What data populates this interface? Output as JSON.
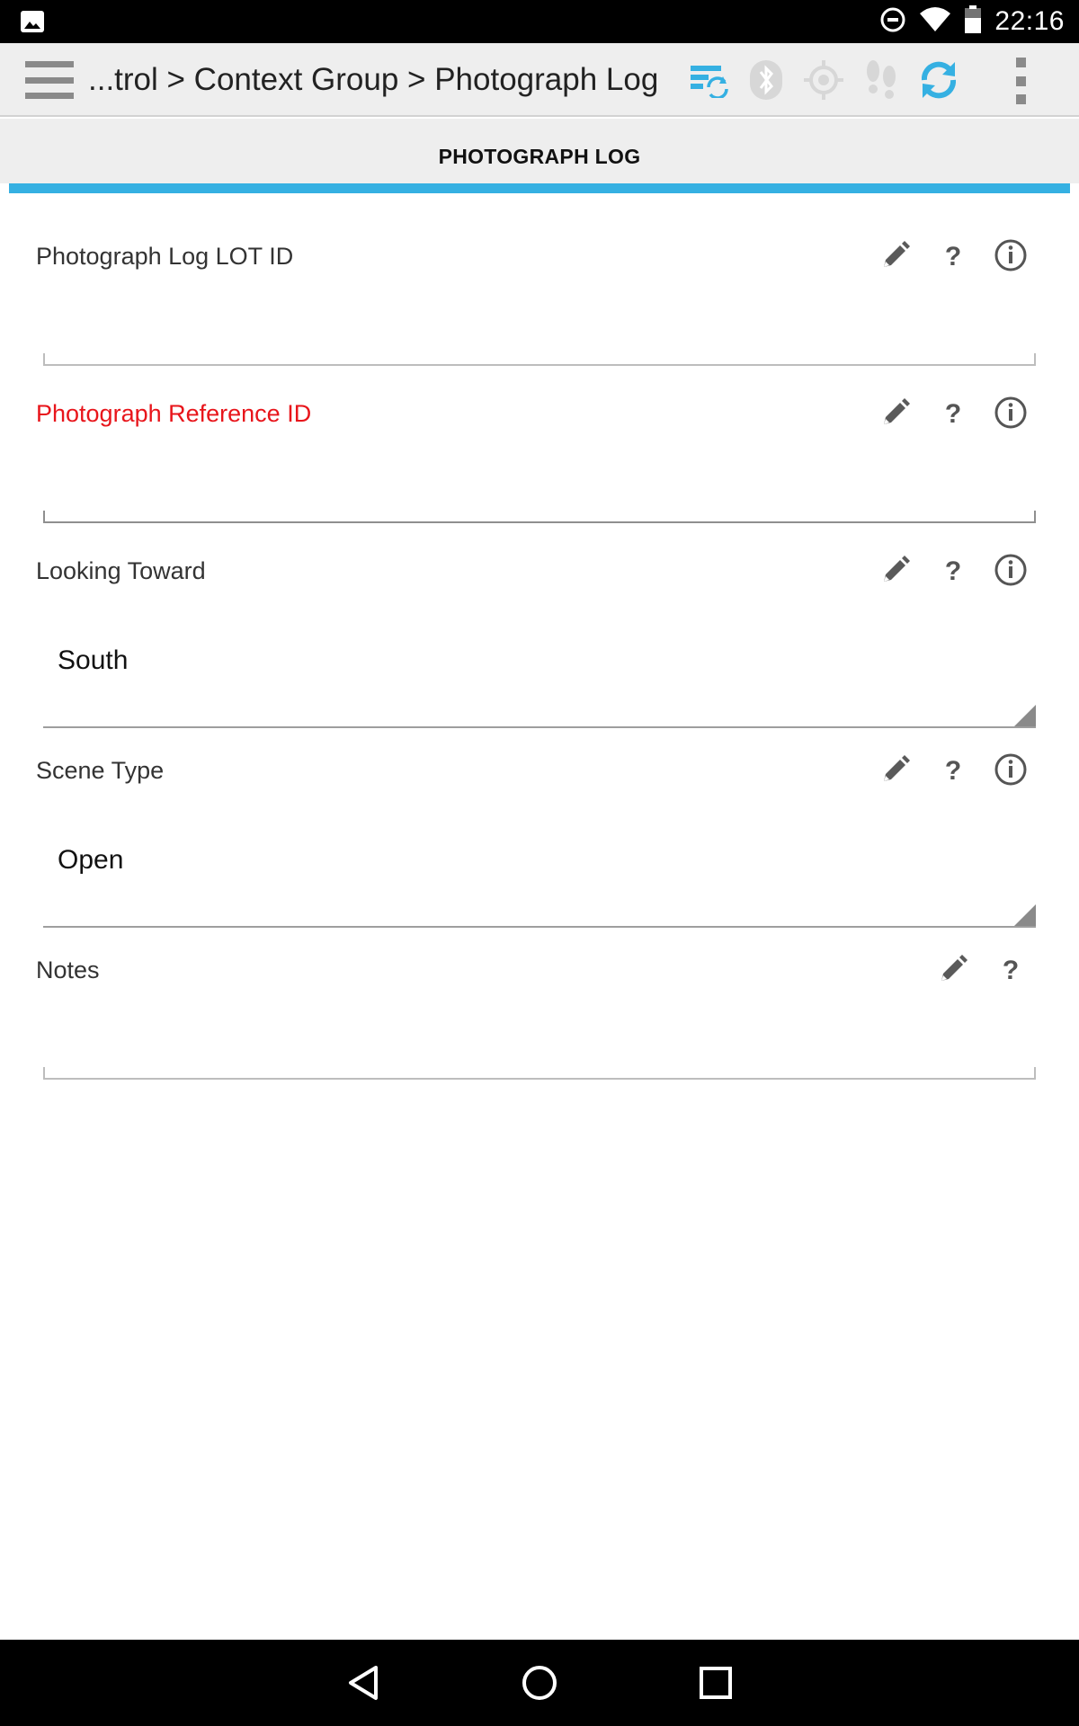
{
  "status_bar": {
    "time": "22:16",
    "icons": [
      "image-notification-icon",
      "do-not-disturb-icon",
      "wifi-icon",
      "battery-icon"
    ]
  },
  "action_bar": {
    "breadcrumb": "...trol > Context Group > Photograph Log",
    "icons": [
      "menu-icon",
      "sync-forms-icon",
      "bluetooth-icon",
      "gps-target-icon",
      "footsteps-icon",
      "refresh-icon",
      "overflow-menu-icon"
    ],
    "colors": {
      "active": "#35b0e2",
      "disabled": "#d7d7d7"
    }
  },
  "tab": {
    "title": "PHOTOGRAPH LOG",
    "indicator_color": "#35b0e2"
  },
  "form": {
    "fields": [
      {
        "label": "Photograph Log LOT ID",
        "type": "text",
        "value": "",
        "required": false,
        "actions": [
          "edit",
          "help",
          "info"
        ]
      },
      {
        "label": "Photograph Reference ID",
        "type": "text",
        "value": "",
        "required": true,
        "actions": [
          "edit",
          "help",
          "info"
        ]
      },
      {
        "label": "Looking Toward",
        "type": "select",
        "value": "South",
        "required": false,
        "actions": [
          "edit",
          "help",
          "info"
        ]
      },
      {
        "label": "Scene Type",
        "type": "select",
        "value": "Open",
        "required": false,
        "actions": [
          "edit",
          "help",
          "info"
        ]
      },
      {
        "label": "Notes",
        "type": "text",
        "value": "",
        "required": false,
        "actions": [
          "edit",
          "help"
        ]
      }
    ],
    "required_color": "#e8151b"
  },
  "nav_bar": {
    "icons": [
      "back-icon",
      "home-icon",
      "recents-icon"
    ]
  }
}
